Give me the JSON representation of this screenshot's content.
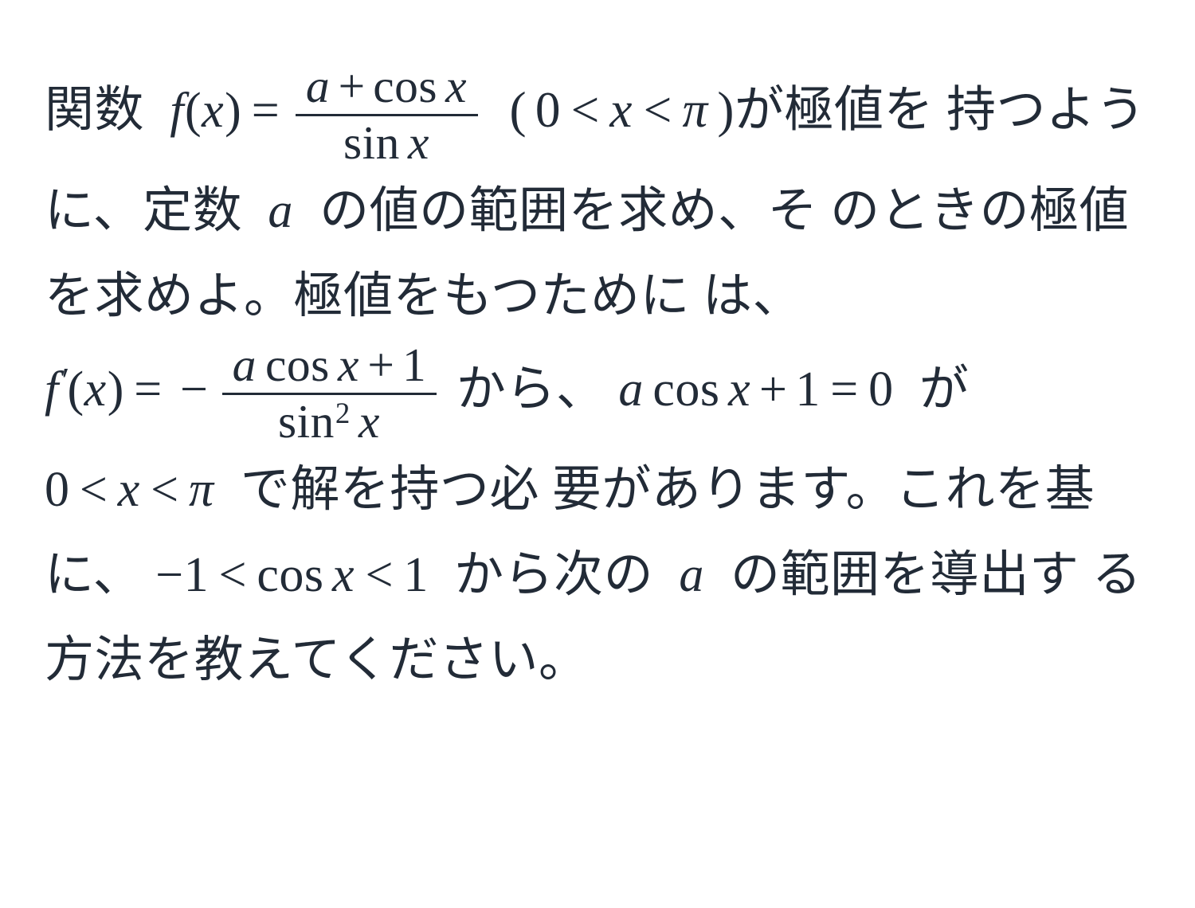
{
  "document": {
    "background_color": "#ffffff",
    "text_color": "#222b37",
    "language": "ja",
    "kind": "math-problem-statement"
  },
  "problem": {
    "full_text": "関数 f(x) = (a + cos x)/(sin x) (0 < x < π) が極値を持つように、定数 a の値の範囲を求め、そのときの極値を求めよ。極値をもつためには、f'(x) = −(a cos x + 1)/(sin^2 x) から、a cos x + 1 = 0 が 0 < x < π で解を持つ必要があります。これを基に、−1 < cos x < 1 から次の a の範囲を導出する方法を教えてください。",
    "segments": {
      "s1_kansu": "関数",
      "s2_fx": "f",
      "s2_paren_open": "(",
      "s2_var": "x",
      "s2_paren_close": ")",
      "s2_equals": "=",
      "frac1_numerator_a": "a",
      "frac1_numerator_plus": "+",
      "frac1_numerator_cos": "cos",
      "frac1_numerator_x": "x",
      "frac1_denominator_sin": "sin",
      "frac1_denominator_x": "x",
      "domain_open": "(",
      "domain_zero": "0",
      "domain_lt1": "<",
      "domain_x": "x",
      "domain_lt2": "<",
      "domain_pi": "π",
      "domain_close": ")",
      "s3_ga_kyokuchi_wo": "が極値を",
      "s4_motsuyouni": "持つように、定数",
      "s4_a": "a",
      "s4_no_atai": "の値の範囲を求め、そ",
      "s5_notokino": "のときの極値を求めよ。極値をもつために",
      "s6_wa": "は、",
      "s6_f": "f",
      "s6_prime": "′",
      "s6_paren_open": "(",
      "s6_x": "x",
      "s6_paren_close": ")",
      "s6_equals": "=",
      "s6_minus": "−",
      "frac2_numerator_a": "a",
      "frac2_numerator_cos": "cos",
      "frac2_numerator_x": "x",
      "frac2_numerator_plus": "+",
      "frac2_numerator_one": "1",
      "frac2_denominator_sin": "sin",
      "frac2_denominator_sup": "2",
      "frac2_denominator_x": "x",
      "s6_kara": "から、",
      "s7_a": "a",
      "s7_cos": "cos",
      "s7_x": "x",
      "s7_plus": "+",
      "s7_one": "1",
      "s7_equals": "=",
      "s7_zero": "0",
      "s7_ga": "が",
      "s7_zero2": "0",
      "s7_lt1": "<",
      "s7_x2": "x",
      "s7_lt2": "<",
      "s7_pi": "π",
      "s7_de_kai": "で解を持つ必",
      "s8_you_ga_arimasu": "要があります。これを基に、",
      "s9_minus_one": "−1",
      "s9_lt1": "<",
      "s9_cos": "cos",
      "s9_x": "x",
      "s9_lt2": "<",
      "s9_one": "1",
      "s9_kara_tsugi_no": "から次の",
      "s9_a": "a",
      "s9_no_hani": "の範囲を導出す",
      "s10_ru_houhou": "る方法を教えてください。"
    }
  }
}
